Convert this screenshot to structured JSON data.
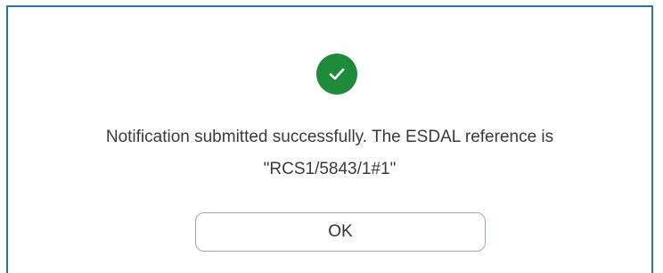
{
  "dialog": {
    "icon": "check-circle-icon",
    "success_color": "#1f8a3a",
    "border_color": "#2f6fa8",
    "message_line1": "Notification submitted successfully. The ESDAL reference is",
    "message_line2": "\"RCS1/5843/1#1\"",
    "ok_label": "OK"
  }
}
